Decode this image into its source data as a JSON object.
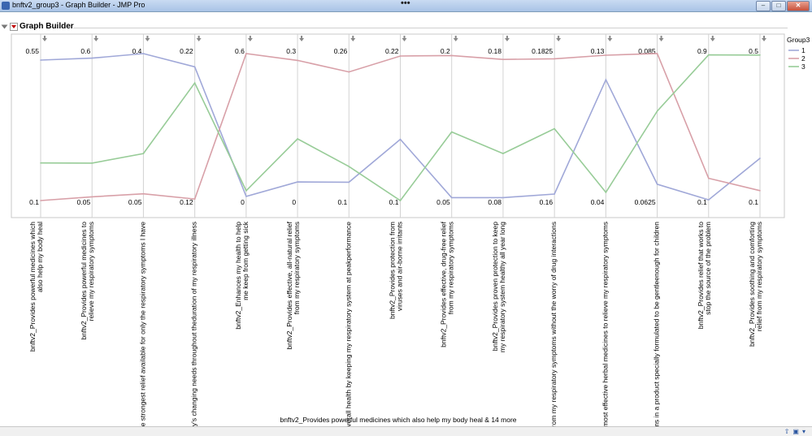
{
  "window": {
    "title": "bnftv2_group3 - Graph Builder - JMP Pro"
  },
  "panel": {
    "title": "Graph Builder"
  },
  "legend": {
    "title": "Group3",
    "items": [
      {
        "label": "1",
        "color": "#a0a8d8"
      },
      {
        "label": "2",
        "color": "#d8a0a8"
      },
      {
        "label": "3",
        "color": "#98cc98"
      }
    ]
  },
  "chart_data": {
    "type": "line",
    "chart_kind": "parallel-plot",
    "xlabel": "bnftv2_Provides powerful medicines which also help my body heal & 14 more",
    "grid": "vertical-axes",
    "legend_position": "right",
    "axes": [
      {
        "label_lines": [
          "bnftv2_Provides powerful medicines which",
          "also help my body heal"
        ],
        "max": "0.55",
        "min": "0.1",
        "max_v": 0.55,
        "min_v": 0.1
      },
      {
        "label_lines": [
          "bnftv2_Provides powerful medicines to",
          "relieve my respiratory symptoms"
        ],
        "max": "0.6",
        "min": "0.05",
        "max_v": 0.6,
        "min_v": 0.05
      },
      {
        "label_lines": [
          "the strongest relief available for only the respiratory symptoms I have"
        ],
        "max": "0.4",
        "min": "0.05",
        "max_v": 0.4,
        "min_v": 0.05
      },
      {
        "label_lines": [
          "ody's changing needs throughout theduration of my respiratory illness"
        ],
        "max": "0.22",
        "min": "0.12",
        "max_v": 0.22,
        "min_v": 0.12
      },
      {
        "label_lines": [
          "bnftv2_Enhances my health to help",
          "me keep from getting sick"
        ],
        "max": "0.6",
        "min": "0",
        "max_v": 0.6,
        "min_v": 0
      },
      {
        "label_lines": [
          "bnftv2_Provides effective, all-natural relief",
          "from my respiratory symptoms"
        ],
        "max": "0.3",
        "min": "0",
        "max_v": 0.3,
        "min_v": 0
      },
      {
        "label_lines": [
          "y overall health by keeping my respiratory system at peakperformance"
        ],
        "max": "0.26",
        "min": "0.1",
        "max_v": 0.26,
        "min_v": 0.1
      },
      {
        "label_lines": [
          "bnftv2_Provides protection from",
          "viruses and air-borne irritants"
        ],
        "max": "0.22",
        "min": "0.1",
        "max_v": 0.22,
        "min_v": 0.1
      },
      {
        "label_lines": [
          "bnftv2_Provides effective, drug-free relief",
          "from my respiratory symptoms"
        ],
        "max": "0.2",
        "min": "0.05",
        "max_v": 0.2,
        "min_v": 0.05
      },
      {
        "label_lines": [
          "bnftv2_Provides proven protection to keep",
          "my respiratory system healthy all year long"
        ],
        "max": "0.18",
        "min": "0.08",
        "max_v": 0.18,
        "min_v": 0.08
      },
      {
        "label_lines": [
          "from my respiratory symptoms without the worry of drug interactions"
        ],
        "max": "0.1825",
        "min": "0.16",
        "max_v": 0.1825,
        "min_v": 0.16
      },
      {
        "label_lines": [
          "e most effective herbal medicines to relieve my respiratory symptoms"
        ],
        "max": "0.13",
        "min": "0.04",
        "max_v": 0.13,
        "min_v": 0.04
      },
      {
        "label_lines": [
          "oms in a product specially formulated to be gentleenough for children"
        ],
        "max": "0.085",
        "min": "0.0625",
        "max_v": 0.085,
        "min_v": 0.0625
      },
      {
        "label_lines": [
          "bnftv2_Provides relief that works to",
          "stop the source of the problem"
        ],
        "max": "0.9",
        "min": "0.1",
        "max_v": 0.9,
        "min_v": 0.1
      },
      {
        "label_lines": [
          "bnftv2_Provides soothing and comforting",
          "relief from my respiratory symptoms"
        ],
        "max": "0.5",
        "min": "0.1",
        "max_v": 0.5,
        "min_v": 0.1
      }
    ],
    "series": [
      {
        "name": "1",
        "color": "#a0a8d8",
        "values": [
          0.53,
          0.583,
          0.4,
          0.211,
          0.017,
          0.038,
          0.12,
          0.15,
          0.053,
          0.082,
          0.161,
          0.114,
          0.065,
          0.104,
          0.215
        ]
      },
      {
        "name": "2",
        "color": "#d8a0a8",
        "values": [
          0.1,
          0.064,
          0.066,
          0.121,
          0.6,
          0.286,
          0.24,
          0.218,
          0.198,
          0.176,
          0.1817,
          0.129,
          0.085,
          0.221,
          0.127
        ]
      },
      {
        "name": "3",
        "color": "#98cc98",
        "values": [
          0.215,
          0.19,
          0.162,
          0.2,
          0.04,
          0.126,
          0.137,
          0.1,
          0.12,
          0.112,
          0.171,
          0.045,
          0.0762,
          0.893,
          0.496
        ]
      }
    ]
  }
}
